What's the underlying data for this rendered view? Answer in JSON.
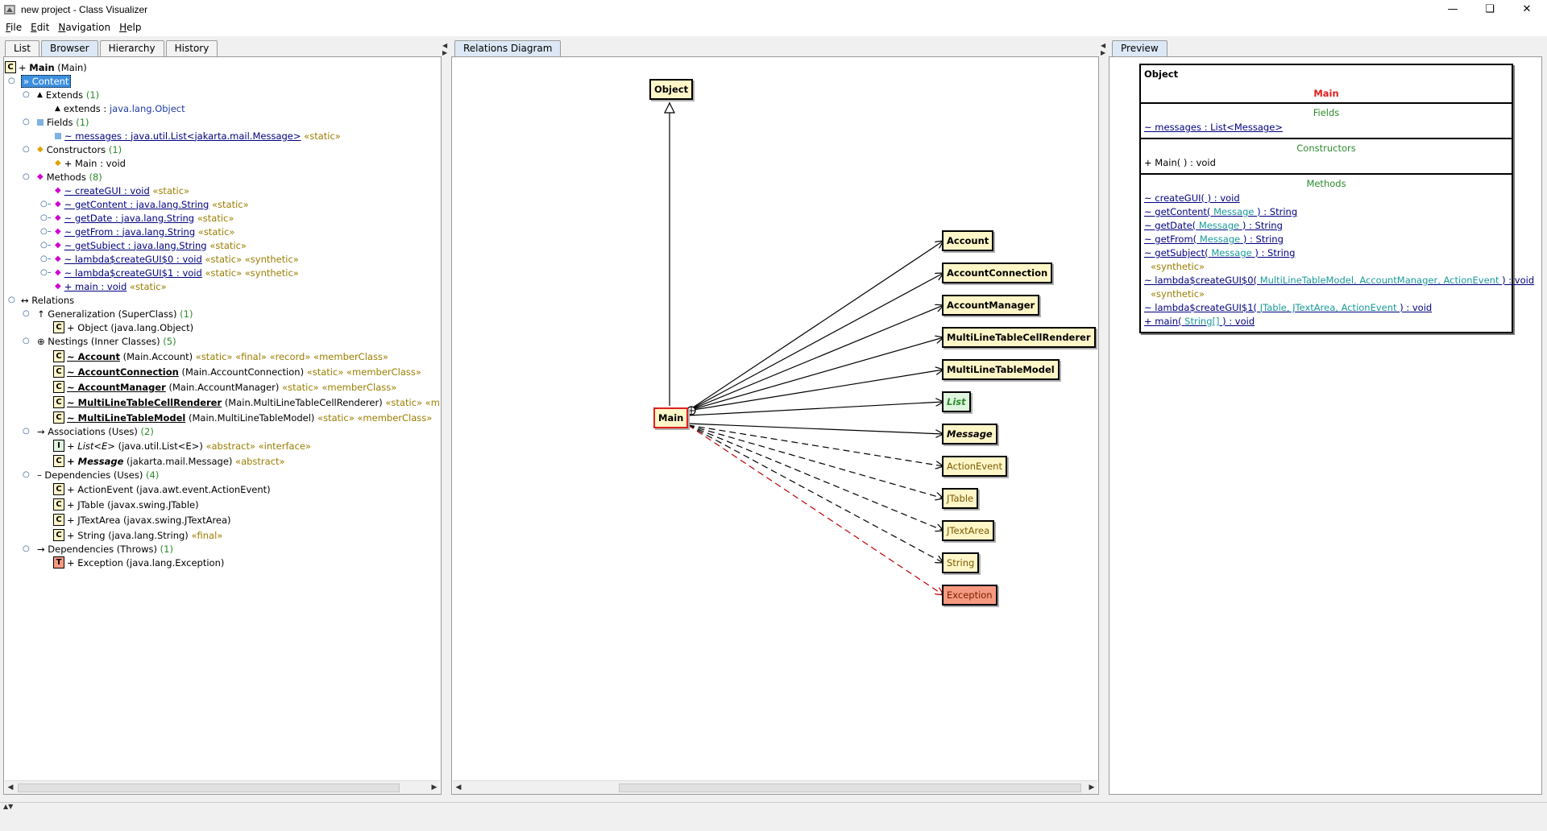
{
  "window": {
    "title": "new project - Class Visualizer"
  },
  "menu": [
    "File",
    "Edit",
    "Navigation",
    "Help"
  ],
  "left_tabs": [
    "List",
    "Browser",
    "Hierarchy",
    "History"
  ],
  "diagram_tab": "Relations Diagram",
  "preview_tab": "Preview",
  "tree": {
    "root": {
      "name": "Main",
      "paren": "(Main)",
      "badge": "C",
      "prefix": "+"
    },
    "content": "Content",
    "extends_hd": "Extends",
    "extends_cnt": "(1)",
    "extends_item": "extends :",
    "extends_val": "java.lang.Object",
    "fields_hd": "Fields",
    "fields_cnt": "(1)",
    "field1": "~ messages : java.util.List<jakarta.mail.Message>",
    "field1_tag": "«static»",
    "ctors_hd": "Constructors",
    "ctors_cnt": "(1)",
    "ctor1": "+ Main : void",
    "methods_hd": "Methods",
    "methods_cnt": "(8)",
    "methods": [
      {
        "name": "~ createGUI : void",
        "tag": "«static»"
      },
      {
        "name": "~ getContent : java.lang.String",
        "tag": "«static»"
      },
      {
        "name": "~ getDate : java.lang.String",
        "tag": "«static»"
      },
      {
        "name": "~ getFrom : java.lang.String",
        "tag": "«static»"
      },
      {
        "name": "~ getSubject : java.lang.String",
        "tag": "«static»"
      },
      {
        "name": "~ lambda$createGUI$0 : void",
        "tag": "«static» «synthetic»"
      },
      {
        "name": "~ lambda$createGUI$1 : void",
        "tag": "«static» «synthetic»"
      },
      {
        "name": "+ main : void",
        "tag": "«static»"
      }
    ],
    "relations": "Relations",
    "gen_hd": "Generalization (SuperClass)",
    "gen_cnt": "(1)",
    "gen1": "+ Object (java.lang.Object)",
    "nest_hd": "Nestings (Inner Classes)",
    "nest_cnt": "(5)",
    "nestings": [
      {
        "name": "~ Account",
        "full": "(Main.Account)",
        "tag": "«static» «final» «record» «memberClass»"
      },
      {
        "name": "~ AccountConnection",
        "full": "(Main.AccountConnection)",
        "tag": "«static» «memberClass»"
      },
      {
        "name": "~ AccountManager",
        "full": "(Main.AccountManager)",
        "tag": "«static» «memberClass»"
      },
      {
        "name": "~ MultiLineTableCellRenderer",
        "full": "(Main.MultiLineTableCellRenderer)",
        "tag": "«static» «member"
      },
      {
        "name": "~ MultiLineTableModel",
        "full": "(Main.MultiLineTableModel)",
        "tag": "«static» «memberClass»"
      }
    ],
    "assoc_hd": "Associations (Uses)",
    "assoc_cnt": "(2)",
    "assoc": [
      {
        "badge": "I",
        "name": "+ List<E>",
        "full": "(java.util.List<E>)",
        "tag": "«abstract» «interface»"
      },
      {
        "badge": "C",
        "name": "+ Message",
        "full": "(jakarta.mail.Message)",
        "tag": "«abstract»"
      }
    ],
    "dep_hd": "Dependencies (Uses)",
    "dep_cnt": "(4)",
    "deps": [
      {
        "name": "+ ActionEvent (java.awt.event.ActionEvent)",
        "tag": ""
      },
      {
        "name": "+ JTable (javax.swing.JTable)",
        "tag": ""
      },
      {
        "name": "+ JTextArea (javax.swing.JTextArea)",
        "tag": ""
      },
      {
        "name": "+ String (java.lang.String)",
        "tag": "«final»"
      }
    ],
    "throws_hd": "Dependencies (Throws)",
    "throws_cnt": "(1)",
    "throws1": "+ Exception (java.lang.Exception)"
  },
  "diagram": {
    "object": "Object",
    "main": "Main",
    "targets": [
      "Account",
      "AccountConnection",
      "AccountManager",
      "MultiLineTableCellRenderer",
      "MultiLineTableModel",
      "List",
      "Message",
      "ActionEvent",
      "JTable",
      "JTextArea",
      "String",
      "Exception"
    ]
  },
  "preview": {
    "header": "Object",
    "classname": "Main",
    "fields_hd": "Fields",
    "field1": "~ messages : List<Message>",
    "ctors_hd": "Constructors",
    "ctor1": "+ Main( ) : void",
    "methods_hd": "Methods",
    "m1": "~ createGUI( ) : void",
    "m2a": "~ getContent(",
    "m2b": "Message",
    "m2c": ") : String",
    "m3a": "~ getDate(",
    "m3b": "Message",
    "m3c": ") : String",
    "m4a": "~ getFrom(",
    "m4b": "Message",
    "m4c": ") : String",
    "m5a": "~ getSubject(",
    "m5b": "Message",
    "m5c": ") : String",
    "synthetic": "«synthetic»",
    "m6a": "~ lambda$createGUI$0(",
    "m6b": "MultiLineTableModel, AccountManager, ActionEvent",
    "m6c": ") : void",
    "m7a": "~ lambda$createGUI$1(",
    "m7b": "JTable, JTextArea, ActionEvent",
    "m7c": ") : void",
    "m8a": "+ main(",
    "m8b": "String[]",
    "m8c": ") : void"
  },
  "colors": {
    "selection": "#3d8fe0",
    "class_fill": "#fff6c8",
    "interface_fill": "#dff5df",
    "exception_fill": "#f59a80",
    "main_border": "#e02020"
  }
}
